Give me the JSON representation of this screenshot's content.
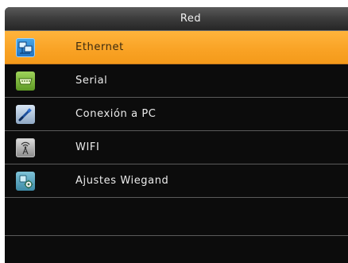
{
  "header": {
    "title": "Red"
  },
  "menu": {
    "items": [
      {
        "label": "Ethernet",
        "icon": "ethernet-network-icon",
        "selected": true
      },
      {
        "label": "Serial",
        "icon": "serial-port-icon",
        "selected": false
      },
      {
        "label": "Conexión a PC",
        "icon": "pc-connection-icon",
        "selected": false
      },
      {
        "label": "WIFI",
        "icon": "wifi-antenna-icon",
        "selected": false
      },
      {
        "label": "Ajustes Wiegand",
        "icon": "wiegand-settings-icon",
        "selected": false
      }
    ]
  },
  "colors": {
    "selected_highlight": "#f9a224",
    "background": "#0c0c0c",
    "divider": "#5b5b5b"
  }
}
